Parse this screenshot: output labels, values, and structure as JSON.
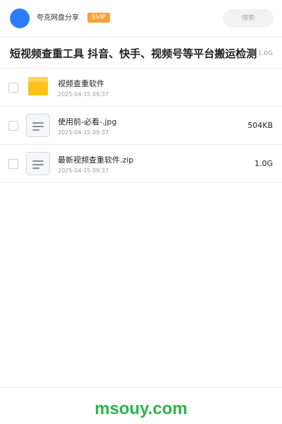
{
  "header": {
    "app_name": "夸克网盘分享",
    "badge": "SVIP",
    "search_placeholder": "搜索"
  },
  "share": {
    "title": "短视频查重工具 抖音、快手、视频号等平台搬运检测",
    "size": "1.0G"
  },
  "files": [
    {
      "icon": "folder-icon",
      "name": "视频查重软件",
      "date": "2025-04-15 09:37",
      "size": ""
    },
    {
      "icon": "document-icon",
      "name": "使用前-必看-.jpg",
      "date": "2025-04-15 09:37",
      "size": "504KB"
    },
    {
      "icon": "document-icon",
      "name": "最新视频查重软件.zip",
      "date": "2025-04-15 09:37",
      "size": "1.0G"
    }
  ],
  "footer": {
    "watermark": "msouy.com"
  },
  "colors": {
    "avatar": "#2f7bff",
    "svip_badge": "#f7a233",
    "folder": "#ffc21a",
    "watermark": "#2fb34a"
  }
}
